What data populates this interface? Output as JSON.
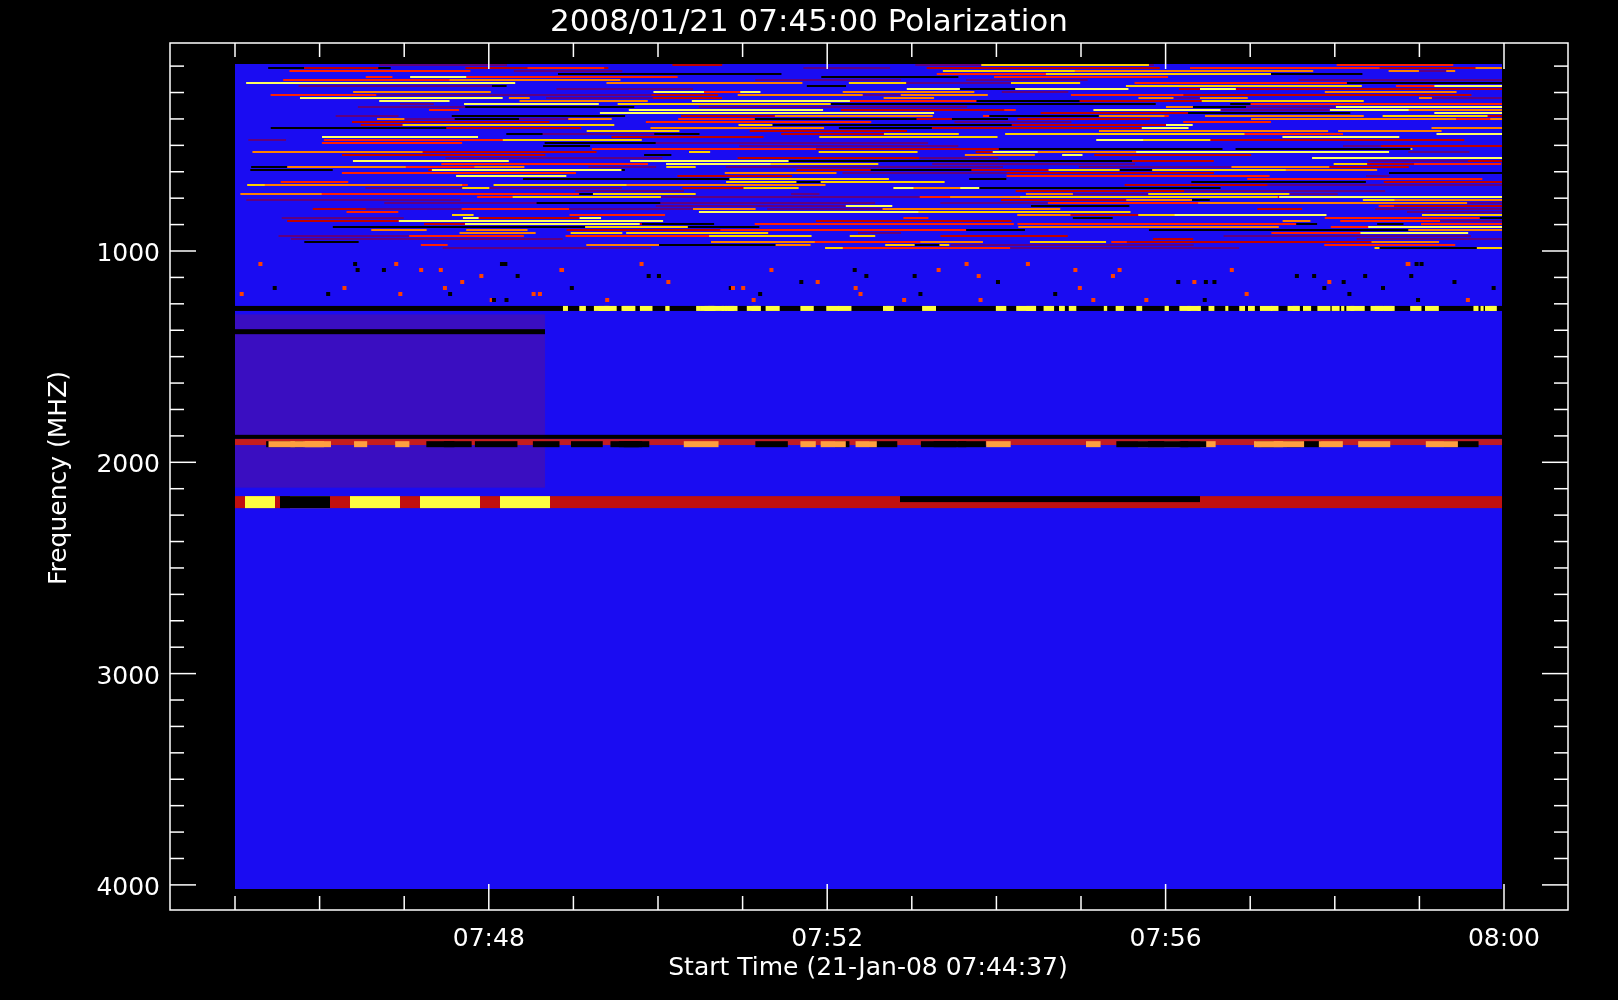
{
  "title": "2008/01/21 07:45:00 Polarization",
  "y_axis": {
    "label": "Frequency (MHZ)",
    "ticks": [
      "1000",
      "2000",
      "3000",
      "4000"
    ]
  },
  "x_axis": {
    "label": "Start Time (21-Jan-08 07:44:37)",
    "ticks": [
      "07:48",
      "07:52",
      "07:56",
      "08:00"
    ]
  }
}
